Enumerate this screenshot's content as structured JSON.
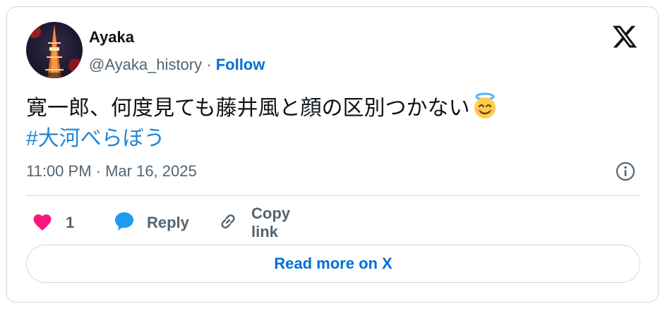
{
  "author": {
    "name": "Ayaka",
    "handle": "@Ayaka_history",
    "separator": "·",
    "follow_label": "Follow"
  },
  "tweet": {
    "text": "寛一郎、何度見ても藤井風と顔の区別つかない",
    "emoji": "smiling-face-with-halo-icon",
    "hashtag": "#大河べらぼう",
    "timestamp": "11:00 PM · Mar 16, 2025"
  },
  "actions": {
    "like_count": "1",
    "reply_label": "Reply",
    "copy_link_label": "Copy link"
  },
  "read_more_label": "Read more on X",
  "colors": {
    "accent": "#006fd6",
    "hashtag": "#1d86d8",
    "like": "#f91880",
    "reply": "#1d9bf0",
    "muted": "#536471",
    "border": "#cfd9de"
  }
}
